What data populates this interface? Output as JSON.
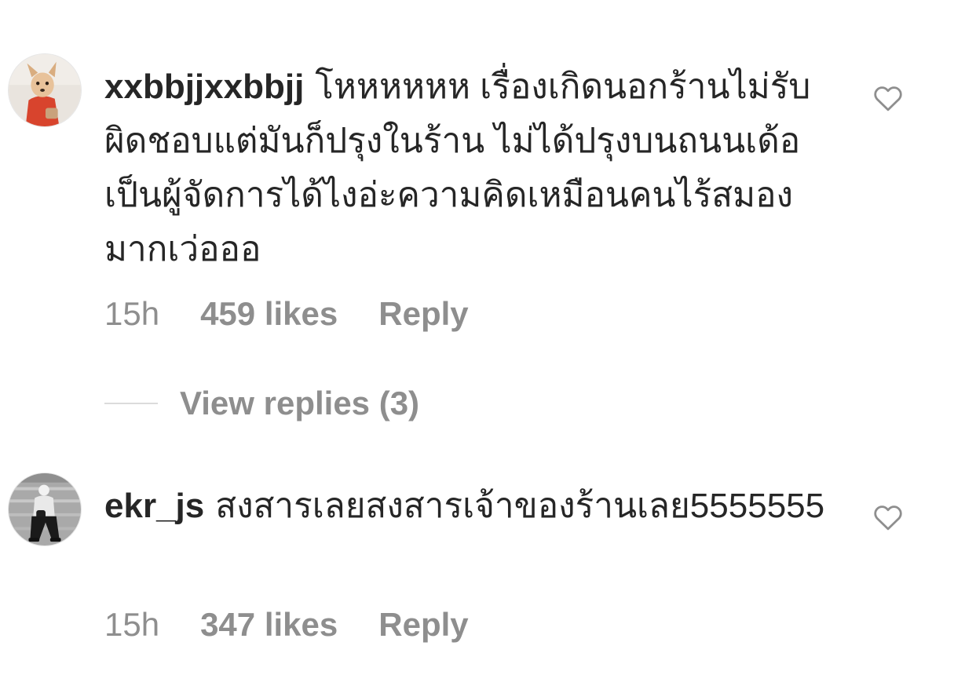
{
  "comments": [
    {
      "username": "xxbbjjxxbbjj",
      "text": "โหหหหหห เรื่องเกิดนอกร้านไม่รับผิดชอบแต่มันก็ปรุงในร้าน ไม่ได้ปรุงบนถนนเด้อ เป็นผู้จัดการได้ไงอ่ะความคิดเหมือนคนไร้สมองมากเว่อออ",
      "time": "15h",
      "likes": "459 likes",
      "reply_label": "Reply",
      "like_icon": "heart-outline-icon"
    },
    {
      "username": "ekr_js",
      "text": "สงสารเลยสงสารเจ้าของร้านเลย5555555",
      "time": "15h",
      "likes": "347 likes",
      "reply_label": "Reply",
      "like_icon": "heart-outline-icon"
    }
  ],
  "view_replies": {
    "label": "View replies (3)"
  },
  "colors": {
    "text": "#262626",
    "secondary": "#8e8e8e",
    "divider": "#dbdbdb"
  }
}
